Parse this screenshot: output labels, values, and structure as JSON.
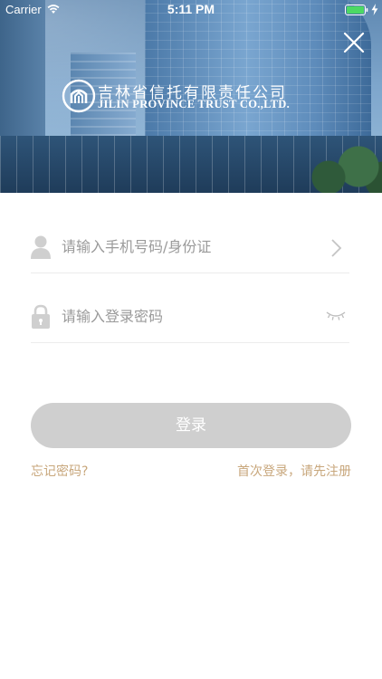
{
  "status_bar": {
    "carrier": "Carrier",
    "time": "5:11 PM",
    "battery_color": "#4cd964"
  },
  "brand": {
    "name_cn": "吉林省信托有限责任公司",
    "name_en": "JILIN PROVINCE TRUST CO.,LTD."
  },
  "form": {
    "phone_placeholder": "请输入手机号码/身份证",
    "password_placeholder": "请输入登录密码",
    "login_label": "登录",
    "forgot_password_label": "忘记密码?",
    "register_label": "首次登录，请先注册"
  },
  "colors": {
    "accent_link": "#c8a77c",
    "button_disabled": "#cfcfcf"
  },
  "icons": {
    "close": "close-icon",
    "user": "user-icon",
    "lock": "lock-icon",
    "chevron": "chevron-right-icon",
    "eye": "eye-closed-icon"
  }
}
